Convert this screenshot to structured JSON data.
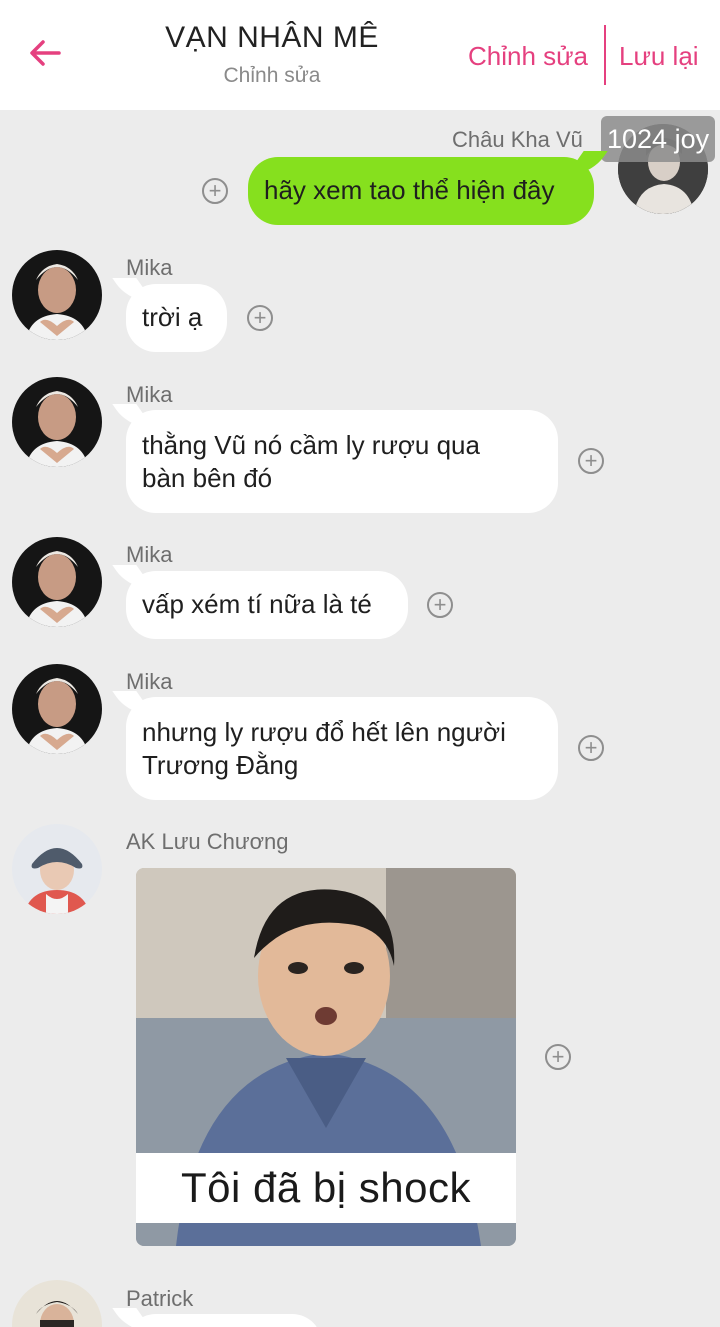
{
  "header": {
    "title": "VẠN NHÂN MÊ",
    "subtitle": "Chỉnh sửa",
    "edit_label": "Chỉnh sửa",
    "save_label": "Lưu lại",
    "accent_color": "#e5407f"
  },
  "messages": [
    {
      "sender": "Châu Kha Vũ",
      "side": "right",
      "text": "hãy xem tao thể hiện đây",
      "badge": "1024 joy",
      "bubble_color": "#86e01e"
    },
    {
      "sender": "Mika",
      "side": "left",
      "text": "trời ạ"
    },
    {
      "sender": "Mika",
      "side": "left",
      "text_lines": [
        "thằng Vũ nó cầm ly rượu qua",
        "bàn bên đó"
      ]
    },
    {
      "sender": "Mika",
      "side": "left",
      "text": "vấp xém tí nữa là té"
    },
    {
      "sender": "Mika",
      "side": "left",
      "text_lines": [
        "nhưng ly rượu đổ hết lên người",
        "Trương Đằng"
      ]
    },
    {
      "sender": "AK Lưu Chương",
      "side": "left",
      "sticker_caption": "Tôi đã bị shock"
    },
    {
      "sender": "Patrick",
      "side": "left"
    }
  ],
  "icons": {
    "back": "arrow-left-icon",
    "add": "plus-circle-icon"
  }
}
